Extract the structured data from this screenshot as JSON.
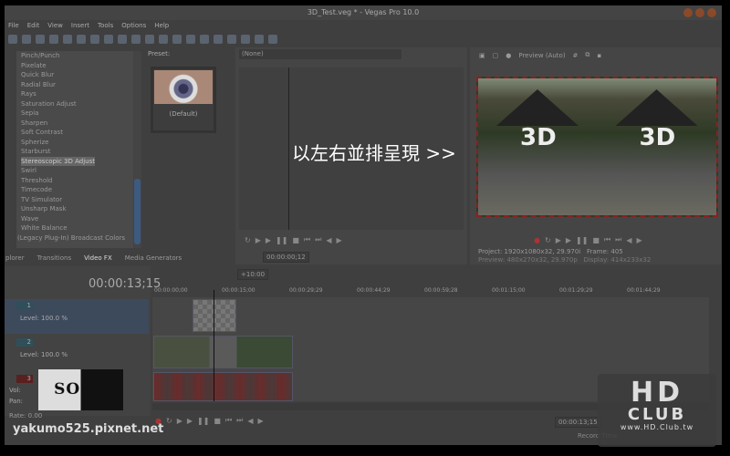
{
  "window": {
    "title": "3D_Test.veg * - Vegas Pro 10.0"
  },
  "menu": [
    "File",
    "Edit",
    "View",
    "Insert",
    "Tools",
    "Options",
    "Help"
  ],
  "fx_list": {
    "items": [
      "Pinch/Punch",
      "Pixelate",
      "Quick Blur",
      "Radial Blur",
      "Rays",
      "Saturation Adjust",
      "Sepia",
      "Sharpen",
      "Soft Contrast",
      "Spherize",
      "Starburst",
      "Stereoscopic 3D Adjust",
      "Swirl",
      "Threshold",
      "Timecode",
      "TV Simulator",
      "Unsharp Mask",
      "Wave",
      "White Balance",
      "(Legacy Plug-In) Broadcast Colors"
    ],
    "selected": "Stereoscopic 3D Adjust"
  },
  "preset": {
    "label": "Preset:",
    "default": "(Default)"
  },
  "tabs": [
    "plorer",
    "Transitions",
    "Video FX",
    "Media Generators"
  ],
  "active_tab": "Video FX",
  "trimmer": {
    "dropdown": "(None)",
    "time": "00:00:00;12"
  },
  "preview": {
    "mode": "Preview (Auto)",
    "project_label": "Project:",
    "project": "1920x1080x32, 29.970i",
    "preview_label": "Preview:",
    "preview_val": "480x270x32, 29.970p",
    "frame_label": "Frame:",
    "frame": "405",
    "display_label": "Display:",
    "display": "414x233x32",
    "clip_text": "3D"
  },
  "overlay_text": "以左右並排呈現 >>",
  "timeline": {
    "current_time": "00:00:13;15",
    "zoom_badge": "+10:00",
    "ruler": [
      "00:00:00;00",
      "00:00:15;00",
      "00:00:29;29",
      "00:00:44;29",
      "00:00:59;28",
      "00:01:15;00",
      "00:01:29;29",
      "00:01:44;29"
    ],
    "tracks": [
      {
        "num": "1",
        "level": "Level: 100.0 %"
      },
      {
        "num": "2",
        "level": "Level: 100.0 %"
      },
      {
        "num": "3",
        "vol": "Vol:",
        "pan": "Pan:"
      }
    ],
    "rate": "Rate: 0.00",
    "record_time": "Record Time",
    "cursor_time": "00:00:13;15"
  },
  "watermarks": {
    "site": "yakumo525.pixnet.net",
    "sony": "SONY",
    "hd": "HD",
    "club": "CLUB",
    "hd_url": "www.HD.Club.tw"
  }
}
